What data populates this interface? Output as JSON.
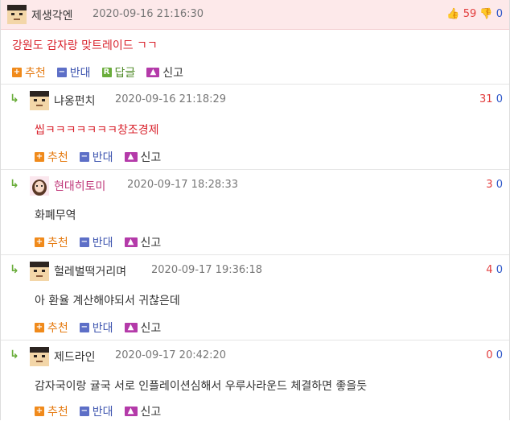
{
  "main_comment": {
    "author": "제생각엔",
    "date": "2020-09-16 21:16:30",
    "upvotes": "59",
    "downvotes": "0",
    "text": "강원도 감자랑 맞트레이드 ㄱㄱ",
    "actions": {
      "recommend": "추천",
      "oppose": "반대",
      "reply": "답글",
      "report": "신고"
    }
  },
  "replies": [
    {
      "author": "냐옹펀치",
      "date": "2020-09-16 21:18:29",
      "upvotes": "31",
      "downvotes": "0",
      "text": "씹ㅋㅋㅋㅋㅋㅋㅋ창조경제"
    },
    {
      "author": "현대히토미",
      "date": "2020-09-17 18:28:33",
      "upvotes": "3",
      "downvotes": "0",
      "text": "화폐무역"
    },
    {
      "author": "헐레벌떡거리며",
      "date": "2020-09-17 19:36:18",
      "upvotes": "4",
      "downvotes": "0",
      "text": "아 환율 계산해야되서 귀찮은데"
    },
    {
      "author": "제드라인",
      "date": "2020-09-17 20:42:20",
      "upvotes": "0",
      "downvotes": "0",
      "text": "감자국이랑 귤국 서로 인플레이션심해서 우루사라운드 체결하면 좋을듯"
    }
  ],
  "reply_actions": {
    "recommend": "추천",
    "oppose": "반대",
    "report": "신고"
  },
  "icons": {
    "upvote": "thumbs-up-icon",
    "downvote": "thumbs-down-icon"
  }
}
